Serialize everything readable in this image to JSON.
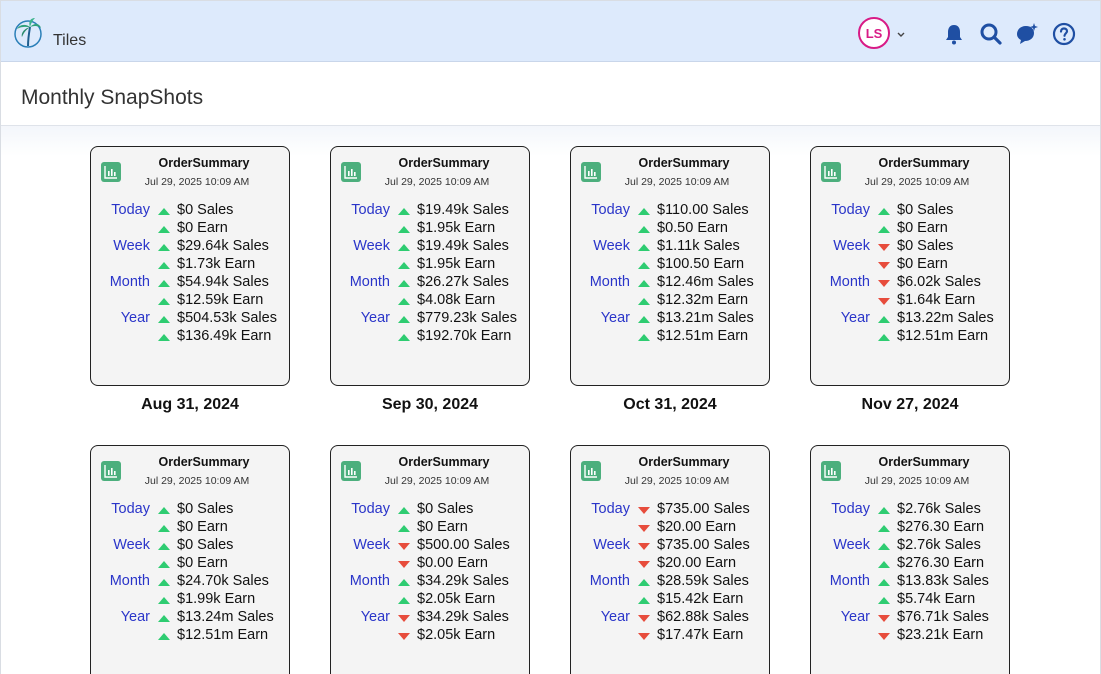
{
  "app": {
    "name": "Tiles"
  },
  "user": {
    "initials": "LS"
  },
  "page": {
    "title": "Monthly SnapShots"
  },
  "colors": {
    "up": "#2ecc71",
    "down": "#e74c3c",
    "label": "#2a35c9",
    "topbar": "#ddeafc",
    "badge": "#4caf7d"
  },
  "topbar_icons": [
    "bell-icon",
    "search-icon",
    "chat-sparkle-icon",
    "help-icon"
  ],
  "cards": [
    {
      "title": "OrderSummary",
      "timestamp": "Jul 29, 2025 10:09 AM",
      "date": "Aug 31, 2024",
      "rows": [
        {
          "label": "Today",
          "dir": "up",
          "value": "$0 Sales"
        },
        {
          "label": "",
          "dir": "up",
          "value": "$0 Earn"
        },
        {
          "label": "Week",
          "dir": "up",
          "value": "$29.64k Sales"
        },
        {
          "label": "",
          "dir": "up",
          "value": "$1.73k Earn"
        },
        {
          "label": "Month",
          "dir": "up",
          "value": "$54.94k Sales"
        },
        {
          "label": "",
          "dir": "up",
          "value": "$12.59k Earn"
        },
        {
          "label": "Year",
          "dir": "up",
          "value": "$504.53k Sales"
        },
        {
          "label": "",
          "dir": "up",
          "value": "$136.49k Earn"
        }
      ]
    },
    {
      "title": "OrderSummary",
      "timestamp": "Jul 29, 2025 10:09 AM",
      "date": "Sep 30, 2024",
      "rows": [
        {
          "label": "Today",
          "dir": "up",
          "value": "$19.49k Sales"
        },
        {
          "label": "",
          "dir": "up",
          "value": "$1.95k Earn"
        },
        {
          "label": "Week",
          "dir": "up",
          "value": "$19.49k Sales"
        },
        {
          "label": "",
          "dir": "up",
          "value": "$1.95k Earn"
        },
        {
          "label": "Month",
          "dir": "up",
          "value": "$26.27k Sales"
        },
        {
          "label": "",
          "dir": "up",
          "value": "$4.08k Earn"
        },
        {
          "label": "Year",
          "dir": "up",
          "value": "$779.23k Sales"
        },
        {
          "label": "",
          "dir": "up",
          "value": "$192.70k Earn"
        }
      ]
    },
    {
      "title": "OrderSummary",
      "timestamp": "Jul 29, 2025 10:09 AM",
      "date": "Oct 31, 2024",
      "rows": [
        {
          "label": "Today",
          "dir": "up",
          "value": "$110.00 Sales"
        },
        {
          "label": "",
          "dir": "up",
          "value": "$0.50 Earn"
        },
        {
          "label": "Week",
          "dir": "up",
          "value": "$1.11k Sales"
        },
        {
          "label": "",
          "dir": "up",
          "value": "$100.50 Earn"
        },
        {
          "label": "Month",
          "dir": "up",
          "value": "$12.46m Sales"
        },
        {
          "label": "",
          "dir": "up",
          "value": "$12.32m Earn"
        },
        {
          "label": "Year",
          "dir": "up",
          "value": "$13.21m Sales"
        },
        {
          "label": "",
          "dir": "up",
          "value": "$12.51m Earn"
        }
      ]
    },
    {
      "title": "OrderSummary",
      "timestamp": "Jul 29, 2025 10:09 AM",
      "date": "Nov 27, 2024",
      "rows": [
        {
          "label": "Today",
          "dir": "up",
          "value": "$0 Sales"
        },
        {
          "label": "",
          "dir": "up",
          "value": "$0 Earn"
        },
        {
          "label": "Week",
          "dir": "down",
          "value": "$0 Sales"
        },
        {
          "label": "",
          "dir": "down",
          "value": "$0 Earn"
        },
        {
          "label": "Month",
          "dir": "down",
          "value": "$6.02k Sales"
        },
        {
          "label": "",
          "dir": "down",
          "value": "$1.64k Earn"
        },
        {
          "label": "Year",
          "dir": "up",
          "value": "$13.22m Sales"
        },
        {
          "label": "",
          "dir": "up",
          "value": "$12.51m Earn"
        }
      ]
    },
    {
      "title": "OrderSummary",
      "timestamp": "Jul 29, 2025 10:09 AM",
      "date": "",
      "rows": [
        {
          "label": "Today",
          "dir": "up",
          "value": "$0 Sales"
        },
        {
          "label": "",
          "dir": "up",
          "value": "$0 Earn"
        },
        {
          "label": "Week",
          "dir": "up",
          "value": "$0 Sales"
        },
        {
          "label": "",
          "dir": "up",
          "value": "$0 Earn"
        },
        {
          "label": "Month",
          "dir": "up",
          "value": "$24.70k Sales"
        },
        {
          "label": "",
          "dir": "up",
          "value": "$1.99k Earn"
        },
        {
          "label": "Year",
          "dir": "up",
          "value": "$13.24m Sales"
        },
        {
          "label": "",
          "dir": "up",
          "value": "$12.51m Earn"
        }
      ]
    },
    {
      "title": "OrderSummary",
      "timestamp": "Jul 29, 2025 10:09 AM",
      "date": "",
      "rows": [
        {
          "label": "Today",
          "dir": "up",
          "value": "$0 Sales"
        },
        {
          "label": "",
          "dir": "up",
          "value": "$0 Earn"
        },
        {
          "label": "Week",
          "dir": "down",
          "value": "$500.00 Sales"
        },
        {
          "label": "",
          "dir": "down",
          "value": "$0.00 Earn"
        },
        {
          "label": "Month",
          "dir": "up",
          "value": "$34.29k Sales"
        },
        {
          "label": "",
          "dir": "up",
          "value": "$2.05k Earn"
        },
        {
          "label": "Year",
          "dir": "down",
          "value": "$34.29k Sales"
        },
        {
          "label": "",
          "dir": "down",
          "value": "$2.05k Earn"
        }
      ]
    },
    {
      "title": "OrderSummary",
      "timestamp": "Jul 29, 2025 10:09 AM",
      "date": "",
      "rows": [
        {
          "label": "Today",
          "dir": "down",
          "value": "$735.00 Sales"
        },
        {
          "label": "",
          "dir": "down",
          "value": "$20.00 Earn"
        },
        {
          "label": "Week",
          "dir": "down",
          "value": "$735.00 Sales"
        },
        {
          "label": "",
          "dir": "down",
          "value": "$20.00 Earn"
        },
        {
          "label": "Month",
          "dir": "up",
          "value": "$28.59k Sales"
        },
        {
          "label": "",
          "dir": "up",
          "value": "$15.42k Earn"
        },
        {
          "label": "Year",
          "dir": "down",
          "value": "$62.88k Sales"
        },
        {
          "label": "",
          "dir": "down",
          "value": "$17.47k Earn"
        }
      ]
    },
    {
      "title": "OrderSummary",
      "timestamp": "Jul 29, 2025 10:09 AM",
      "date": "",
      "rows": [
        {
          "label": "Today",
          "dir": "up",
          "value": "$2.76k Sales"
        },
        {
          "label": "",
          "dir": "up",
          "value": "$276.30 Earn"
        },
        {
          "label": "Week",
          "dir": "up",
          "value": "$2.76k Sales"
        },
        {
          "label": "",
          "dir": "up",
          "value": "$276.30 Earn"
        },
        {
          "label": "Month",
          "dir": "up",
          "value": "$13.83k Sales"
        },
        {
          "label": "",
          "dir": "up",
          "value": "$5.74k Earn"
        },
        {
          "label": "Year",
          "dir": "down",
          "value": "$76.71k Sales"
        },
        {
          "label": "",
          "dir": "down",
          "value": "$23.21k Earn"
        }
      ]
    }
  ]
}
